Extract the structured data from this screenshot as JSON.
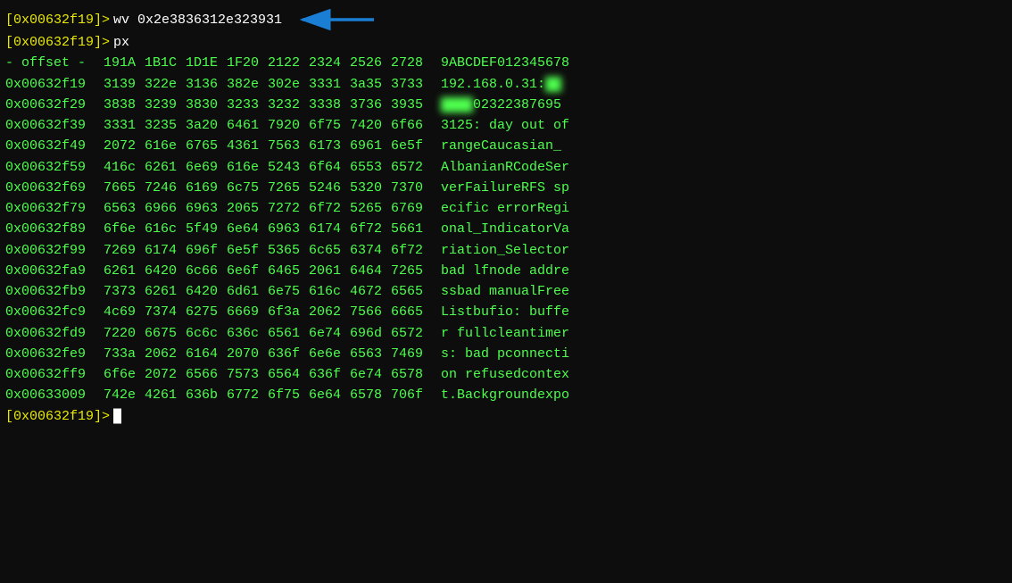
{
  "terminal": {
    "bg": "#0d0d0d",
    "lines": [
      {
        "type": "prompt-cmd",
        "prompt": "[0x00632f19]>",
        "cmd": "wv 0x2e3836312e323931",
        "has_arrow": true
      },
      {
        "type": "prompt-cmd",
        "prompt": "[0x00632f19]>",
        "cmd": "px"
      },
      {
        "type": "header",
        "offset": "- offset -",
        "cols": [
          "191A",
          "1B1C",
          "1D1E",
          "1F20",
          "2122",
          "2324",
          "2526",
          "2728"
        ],
        "ascii": "9ABCDEF012345678"
      },
      {
        "type": "data",
        "addr": "0x00632f19",
        "cols": [
          "3139",
          "322e",
          "3136",
          "382e",
          "302e",
          "3331",
          "3a35",
          "3733"
        ],
        "ascii": "192.168.0.31:██"
      },
      {
        "type": "data",
        "addr": "0x00632f29",
        "cols": [
          "3838",
          "3239",
          "3830",
          "3233",
          "3232",
          "3338",
          "3736",
          "3935"
        ],
        "ascii": "████02322387695"
      },
      {
        "type": "data",
        "addr": "0x00632f39",
        "cols": [
          "3331",
          "3235",
          "3a20",
          "6461",
          "7920",
          "6f75",
          "7420",
          "6f66"
        ],
        "ascii": "3125: day out of"
      },
      {
        "type": "data",
        "addr": "0x00632f49",
        "cols": [
          "2072",
          "616e",
          "6765",
          "4361",
          "7563",
          "6173",
          "6961",
          "6e5f"
        ],
        "ascii": " rangeCaucasian_"
      },
      {
        "type": "data",
        "addr": "0x00632f59",
        "cols": [
          "416c",
          "6261",
          "6e69",
          "616e",
          "5243",
          "6f64",
          "6553",
          "6572"
        ],
        "ascii": "AlbanianRCodeSer"
      },
      {
        "type": "data",
        "addr": "0x00632f69",
        "cols": [
          "7665",
          "7246",
          "6169",
          "6c75",
          "7265",
          "5246",
          "5320",
          "7370"
        ],
        "ascii": "verFailureRFS sp"
      },
      {
        "type": "data",
        "addr": "0x00632f79",
        "cols": [
          "6563",
          "6966",
          "6963",
          "2065",
          "7272",
          "6f72",
          "5265",
          "6769"
        ],
        "ascii": "ecific errorRegi"
      },
      {
        "type": "data",
        "addr": "0x00632f89",
        "cols": [
          "6f6e",
          "616c",
          "5f49",
          "6e64",
          "6963",
          "6174",
          "6f72",
          "5661"
        ],
        "ascii": "onal_IndicatorVa"
      },
      {
        "type": "data",
        "addr": "0x00632f99",
        "cols": [
          "7269",
          "6174",
          "696f",
          "6e5f",
          "5365",
          "6c65",
          "6374",
          "6f72"
        ],
        "ascii": "riation_Selector"
      },
      {
        "type": "data",
        "addr": "0x00632fa9",
        "cols": [
          "6261",
          "6420",
          "6c66",
          "6e6f",
          "6465",
          "2061",
          "6464",
          "7265"
        ],
        "ascii": "bad lfnode addre"
      },
      {
        "type": "data",
        "addr": "0x00632fb9",
        "cols": [
          "7373",
          "6261",
          "6420",
          "6d61",
          "6e75",
          "616c",
          "4672",
          "6565"
        ],
        "ascii": "ssbad manualFree"
      },
      {
        "type": "data",
        "addr": "0x00632fc9",
        "cols": [
          "4c69",
          "7374",
          "6275",
          "6669",
          "6f3a",
          "2062",
          "7566",
          "6665"
        ],
        "ascii": "Listbufio: buffe"
      },
      {
        "type": "data",
        "addr": "0x00632fd9",
        "cols": [
          "7220",
          "6675",
          "6c6c",
          "636c",
          "6561",
          "6e74",
          "696d",
          "6572"
        ],
        "ascii": "r fullcleantimer"
      },
      {
        "type": "data",
        "addr": "0x00632fe9",
        "cols": [
          "733a",
          "2062",
          "6164",
          "2070",
          "636f",
          "6e6e",
          "6563",
          "7469"
        ],
        "ascii": "s: bad pconnecti"
      },
      {
        "type": "data",
        "addr": "0x00632ff9",
        "cols": [
          "6f6e",
          "2072",
          "6566",
          "7573",
          "6564",
          "636f",
          "6e74",
          "6578"
        ],
        "ascii": "on refusedcontex"
      },
      {
        "type": "data",
        "addr": "0x00633009",
        "cols": [
          "742e",
          "4261",
          "636b",
          "6772",
          "6f75",
          "6e64",
          "6578",
          "706f"
        ],
        "ascii": "t.Backgroundexpo"
      },
      {
        "type": "prompt-only",
        "prompt": "[0x00632f19]>"
      }
    ]
  }
}
